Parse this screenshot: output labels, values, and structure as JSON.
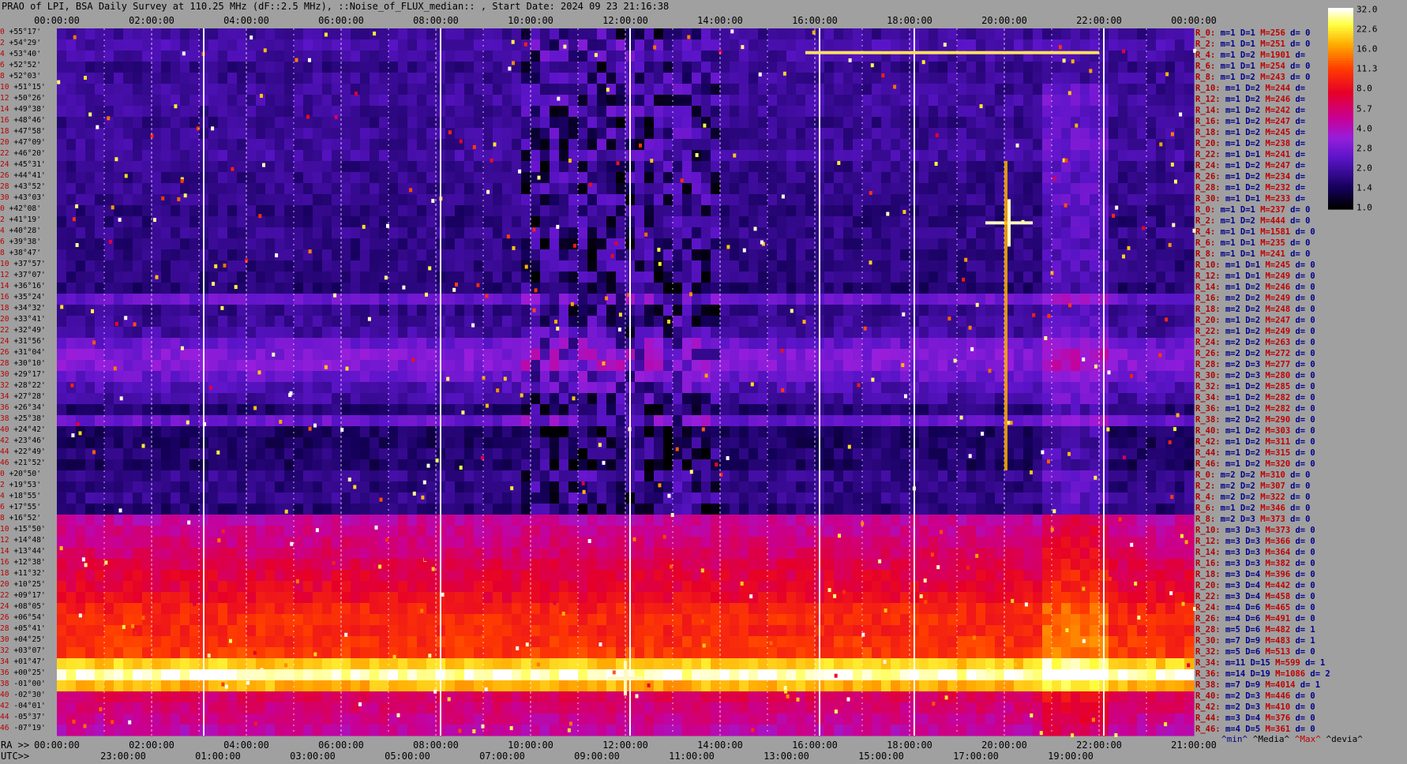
{
  "title": "PRAO of LPI, BSA Daily Survey at 110.25 MHz (dF::2.5 MHz), ::Noise_of_FLUX_median:: , Start Date: 2024 09 23 21:16:38",
  "ra_prefix": "RA >>",
  "utc_prefix": "UTC>>",
  "legend_footer": {
    "min": "^min^",
    "median": "^Media^",
    "max": "^Max^",
    "devia": "^devia^"
  },
  "colors": {
    "background": "#a0a0a0",
    "stat_label": "#b00000",
    "stat_value": "#00008b",
    "stat_max": "#c00000"
  },
  "chart_data": {
    "type": "heatmap",
    "top_time_ticks": [
      "00:00:00",
      "02:00:00",
      "04:00:00",
      "06:00:00",
      "08:00:00",
      "10:00:00",
      "12:00:00",
      "14:00:00",
      "16:00:00",
      "18:00:00",
      "20:00:00",
      "22:00:00",
      "00:00:00"
    ],
    "ra_ticks": [
      "00:00:00",
      "02:00:00",
      "04:00:00",
      "06:00:00",
      "08:00:00",
      "10:00:00",
      "12:00:00",
      "14:00:00",
      "16:00:00",
      "18:00:00",
      "20:00:00",
      "22:00:00",
      "21:00:00"
    ],
    "utc_ticks": [
      "23:00:00",
      "01:00:00",
      "03:00:00",
      "05:00:00",
      "07:00:00",
      "09:00:00",
      "11:00:00",
      "13:00:00",
      "15:00:00",
      "17:00:00",
      "19:00:00"
    ],
    "colorbar": {
      "ticks": [
        "32.0",
        "22.6",
        "16.0",
        "11.3",
        "8.0",
        "5.7",
        "4.0",
        "2.8",
        "2.0",
        "1.4",
        "1.0"
      ],
      "min": 1.0,
      "max": 32.0,
      "scale": "log"
    },
    "dec_labels": [
      "+55°17'",
      "+54°29'",
      "+53°40'",
      "+52°52'",
      "+52°03'",
      "+51°15'",
      "+50°26'",
      "+49°38'",
      "+48°46'",
      "+47°58'",
      "+47°09'",
      "+46°20'",
      "+45°31'",
      "+44°41'",
      "+43°52'",
      "+43°03'",
      "+42°08'",
      "+41°19'",
      "+40°28'",
      "+39°38'",
      "+38°47'",
      "+37°57'",
      "+37°07'",
      "+36°16'",
      "+35°24'",
      "+34°32'",
      "+33°41'",
      "+32°49'",
      "+31°56'",
      "+31°04'",
      "+30°10'",
      "+29°17'",
      "+28°22'",
      "+27°28'",
      "+26°34'",
      "+25°38'",
      "+24°42'",
      "+23°46'",
      "+22°49'",
      "+21°52'",
      "+20°50'",
      "+19°53'",
      "+18°55'",
      "+17°55'",
      "+16°52'",
      "+15°50'",
      "+14°48'",
      "+13°44'",
      "+12°38'",
      "+11°32'",
      "+10°25'",
      "+09°17'",
      "+08°05'",
      "+06°54'",
      "+05°41'",
      "+04°25'",
      "+03°07'",
      "+01°47'",
      "+00°25'",
      "-01°00'",
      "-02°30'",
      "-04°01'",
      "-05°37'",
      "-07°19'"
    ],
    "dec_index": [
      "0",
      "2",
      "4",
      "6",
      "8",
      "10",
      "12",
      "14",
      "16",
      "18",
      "20",
      "22",
      "24",
      "26",
      "28",
      "30",
      "0",
      "2",
      "4",
      "6",
      "8",
      "10",
      "12",
      "14",
      "16",
      "18",
      "20",
      "22",
      "24",
      "26",
      "28",
      "30",
      "32",
      "34",
      "36",
      "38",
      "40",
      "42",
      "44",
      "46",
      "0",
      "2",
      "4",
      "6",
      "8",
      "10",
      "12",
      "14",
      "16",
      "18",
      "20",
      "22",
      "24",
      "26",
      "28",
      "30",
      "32",
      "34",
      "36",
      "38",
      "40",
      "42",
      "44",
      "46"
    ],
    "row_levels": [
      1.9,
      2.1,
      2.0,
      1.8,
      1.9,
      1.9,
      2.0,
      1.9,
      1.8,
      1.9,
      1.9,
      2.0,
      1.8,
      1.8,
      1.8,
      1.8,
      1.7,
      1.7,
      1.8,
      1.7,
      1.7,
      1.7,
      1.7,
      1.6,
      2.6,
      1.8,
      1.9,
      2.0,
      2.6,
      3.0,
      3.0,
      2.6,
      2.2,
      2.0,
      1.6,
      2.6,
      1.5,
      1.5,
      1.6,
      1.5,
      1.8,
      1.7,
      1.8,
      1.6,
      4.6,
      5.0,
      5.4,
      5.8,
      6.4,
      7.0,
      7.4,
      8.0,
      9.5,
      10.0,
      10.0,
      10.5,
      11.0,
      20.0,
      30.0,
      18.0,
      6.0,
      5.5,
      5.0,
      4.5
    ],
    "stats": [
      {
        "r": "R_0:",
        "m": "m=1",
        "d": "D=1",
        "M": "M=256",
        "dv": "d= 0"
      },
      {
        "r": "R_2:",
        "m": "m=1",
        "d": "D=1",
        "M": "M=251",
        "dv": "d= 0"
      },
      {
        "r": "R_4:",
        "m": "m=1",
        "d": "D=2",
        "M": "M=1901",
        "dv": "d="
      },
      {
        "r": "R_6:",
        "m": "m=1",
        "d": "D=1",
        "M": "M=254",
        "dv": "d= 0"
      },
      {
        "r": "R_8:",
        "m": "m=1",
        "d": "D=2",
        "M": "M=243",
        "dv": "d= 0"
      },
      {
        "r": "R_10:",
        "m": "m=1",
        "d": "D=2",
        "M": "M=244",
        "dv": "d="
      },
      {
        "r": "R_12:",
        "m": "m=1",
        "d": "D=2",
        "M": "M=246",
        "dv": "d="
      },
      {
        "r": "R_14:",
        "m": "m=1",
        "d": "D=2",
        "M": "M=242",
        "dv": "d="
      },
      {
        "r": "R_16:",
        "m": "m=1",
        "d": "D=2",
        "M": "M=247",
        "dv": "d="
      },
      {
        "r": "R_18:",
        "m": "m=1",
        "d": "D=2",
        "M": "M=245",
        "dv": "d="
      },
      {
        "r": "R_20:",
        "m": "m=1",
        "d": "D=2",
        "M": "M=238",
        "dv": "d="
      },
      {
        "r": "R_22:",
        "m": "m=1",
        "d": "D=1",
        "M": "M=241",
        "dv": "d="
      },
      {
        "r": "R_24:",
        "m": "m=1",
        "d": "D=2",
        "M": "M=247",
        "dv": "d="
      },
      {
        "r": "R_26:",
        "m": "m=1",
        "d": "D=2",
        "M": "M=234",
        "dv": "d="
      },
      {
        "r": "R_28:",
        "m": "m=1",
        "d": "D=2",
        "M": "M=232",
        "dv": "d="
      },
      {
        "r": "R_30:",
        "m": "m=1",
        "d": "D=1",
        "M": "M=233",
        "dv": "d="
      },
      {
        "r": "R_0:",
        "m": "m=1",
        "d": "D=1",
        "M": "M=237",
        "dv": "d= 0"
      },
      {
        "r": "R_2:",
        "m": "m=1",
        "d": "D=2",
        "M": "M=444",
        "dv": "d= 0"
      },
      {
        "r": "R_4:",
        "m": "m=1",
        "d": "D=1",
        "M": "M=1581",
        "dv": "d= 0"
      },
      {
        "r": "R_6:",
        "m": "m=1",
        "d": "D=1",
        "M": "M=235",
        "dv": "d= 0"
      },
      {
        "r": "R_8:",
        "m": "m=1",
        "d": "D=1",
        "M": "M=241",
        "dv": "d= 0"
      },
      {
        "r": "R_10:",
        "m": "m=1",
        "d": "D=1",
        "M": "M=245",
        "dv": "d= 0"
      },
      {
        "r": "R_12:",
        "m": "m=1",
        "d": "D=1",
        "M": "M=249",
        "dv": "d= 0"
      },
      {
        "r": "R_14:",
        "m": "m=1",
        "d": "D=2",
        "M": "M=246",
        "dv": "d= 0"
      },
      {
        "r": "R_16:",
        "m": "m=2",
        "d": "D=2",
        "M": "M=249",
        "dv": "d= 0"
      },
      {
        "r": "R_18:",
        "m": "m=2",
        "d": "D=2",
        "M": "M=248",
        "dv": "d= 0"
      },
      {
        "r": "R_20:",
        "m": "m=1",
        "d": "D=2",
        "M": "M=247",
        "dv": "d= 0"
      },
      {
        "r": "R_22:",
        "m": "m=1",
        "d": "D=2",
        "M": "M=249",
        "dv": "d= 0"
      },
      {
        "r": "R_24:",
        "m": "m=2",
        "d": "D=2",
        "M": "M=263",
        "dv": "d= 0"
      },
      {
        "r": "R_26:",
        "m": "m=2",
        "d": "D=2",
        "M": "M=272",
        "dv": "d= 0"
      },
      {
        "r": "R_28:",
        "m": "m=2",
        "d": "D=3",
        "M": "M=277",
        "dv": "d= 0"
      },
      {
        "r": "R_30:",
        "m": "m=2",
        "d": "D=3",
        "M": "M=280",
        "dv": "d= 0"
      },
      {
        "r": "R_32:",
        "m": "m=1",
        "d": "D=2",
        "M": "M=285",
        "dv": "d= 0"
      },
      {
        "r": "R_34:",
        "m": "m=1",
        "d": "D=2",
        "M": "M=282",
        "dv": "d= 0"
      },
      {
        "r": "R_36:",
        "m": "m=1",
        "d": "D=2",
        "M": "M=282",
        "dv": "d= 0"
      },
      {
        "r": "R_38:",
        "m": "m=2",
        "d": "D=2",
        "M": "M=290",
        "dv": "d= 0"
      },
      {
        "r": "R_40:",
        "m": "m=1",
        "d": "D=2",
        "M": "M=303",
        "dv": "d= 0"
      },
      {
        "r": "R_42:",
        "m": "m=1",
        "d": "D=2",
        "M": "M=311",
        "dv": "d= 0"
      },
      {
        "r": "R_44:",
        "m": "m=1",
        "d": "D=2",
        "M": "M=315",
        "dv": "d= 0"
      },
      {
        "r": "R_46:",
        "m": "m=1",
        "d": "D=2",
        "M": "M=320",
        "dv": "d= 0"
      },
      {
        "r": "R_0:",
        "m": "m=2",
        "d": "D=2",
        "M": "M=310",
        "dv": "d= 0"
      },
      {
        "r": "R_2:",
        "m": "m=2",
        "d": "D=2",
        "M": "M=307",
        "dv": "d= 0"
      },
      {
        "r": "R_4:",
        "m": "m=2",
        "d": "D=2",
        "M": "M=322",
        "dv": "d= 0"
      },
      {
        "r": "R_6:",
        "m": "m=1",
        "d": "D=2",
        "M": "M=346",
        "dv": "d= 0"
      },
      {
        "r": "R_8:",
        "m": "m=2",
        "d": "D=3",
        "M": "M=373",
        "dv": "d= 0"
      },
      {
        "r": "R_10:",
        "m": "m=3",
        "d": "D=3",
        "M": "M=373",
        "dv": "d= 0"
      },
      {
        "r": "R_12:",
        "m": "m=3",
        "d": "D=3",
        "M": "M=366",
        "dv": "d= 0"
      },
      {
        "r": "R_14:",
        "m": "m=3",
        "d": "D=3",
        "M": "M=364",
        "dv": "d= 0"
      },
      {
        "r": "R_16:",
        "m": "m=3",
        "d": "D=3",
        "M": "M=382",
        "dv": "d= 0"
      },
      {
        "r": "R_18:",
        "m": "m=3",
        "d": "D=4",
        "M": "M=396",
        "dv": "d= 0"
      },
      {
        "r": "R_20:",
        "m": "m=3",
        "d": "D=4",
        "M": "M=442",
        "dv": "d= 0"
      },
      {
        "r": "R_22:",
        "m": "m=3",
        "d": "D=4",
        "M": "M=458",
        "dv": "d= 0"
      },
      {
        "r": "R_24:",
        "m": "m=4",
        "d": "D=6",
        "M": "M=465",
        "dv": "d= 0"
      },
      {
        "r": "R_26:",
        "m": "m=4",
        "d": "D=6",
        "M": "M=491",
        "dv": "d= 0"
      },
      {
        "r": "R_28:",
        "m": "m=5",
        "d": "D=6",
        "M": "M=482",
        "dv": "d= 1"
      },
      {
        "r": "R_30:",
        "m": "m=7",
        "d": "D=9",
        "M": "M=483",
        "dv": "d= 1"
      },
      {
        "r": "R_32:",
        "m": "m=5",
        "d": "D=6",
        "M": "M=513",
        "dv": "d= 0"
      },
      {
        "r": "R_34:",
        "m": "m=11",
        "d": "D=15",
        "M": "M=599",
        "dv": "d= 1"
      },
      {
        "r": "R_36:",
        "m": "m=14",
        "d": "D=19",
        "M": "M=1086",
        "dv": "d= 2"
      },
      {
        "r": "R_38:",
        "m": "m=7",
        "d": "D=9",
        "M": "M=4014",
        "dv": "d= 1"
      },
      {
        "r": "R_40:",
        "m": "m=2",
        "d": "D=3",
        "M": "M=446",
        "dv": "d= 0"
      },
      {
        "r": "R_42:",
        "m": "m=2",
        "d": "D=3",
        "M": "M=410",
        "dv": "d= 0"
      },
      {
        "r": "R_44:",
        "m": "m=3",
        "d": "D=4",
        "M": "M=376",
        "dv": "d= 0"
      },
      {
        "r": "R_46:",
        "m": "m=4",
        "d": "D=5",
        "M": "M=361",
        "dv": "d= 0"
      }
    ]
  }
}
